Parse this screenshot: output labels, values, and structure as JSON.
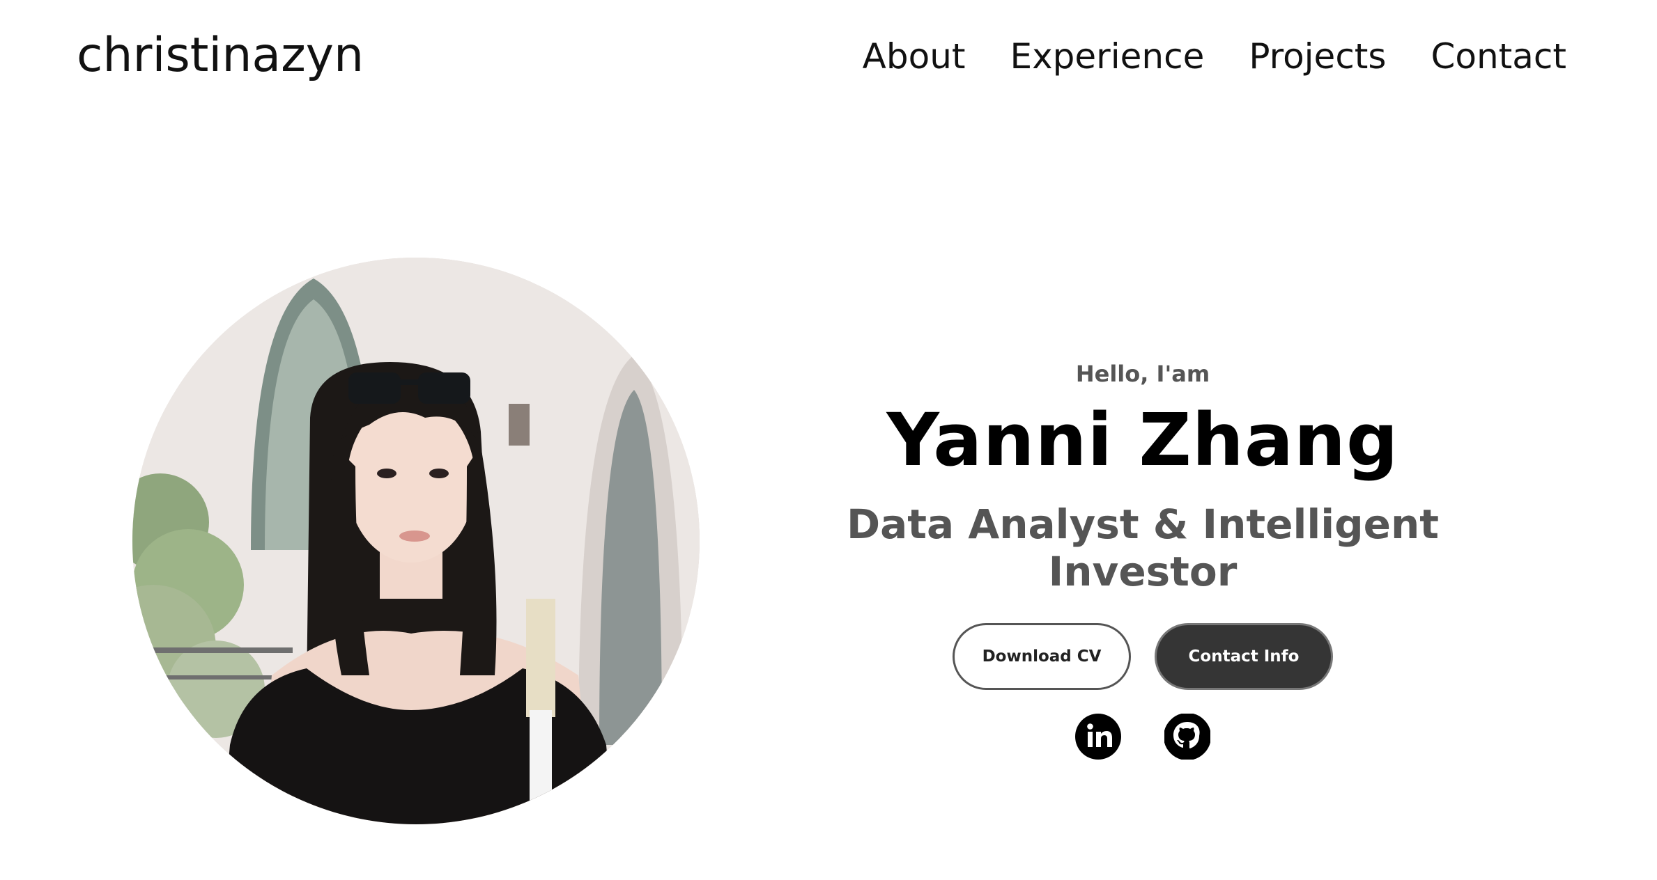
{
  "nav": {
    "logo": "christinazyn",
    "links": [
      "About",
      "Experience",
      "Projects",
      "Contact"
    ]
  },
  "hero": {
    "greeting": "Hello, I'am",
    "name": "Yanni Zhang",
    "title": "Data Analyst & Intelligent Investor",
    "buttons": {
      "download": "Download CV",
      "contact": "Contact Info"
    },
    "social": [
      {
        "icon": "linkedin-icon"
      },
      {
        "icon": "github-icon"
      }
    ]
  },
  "colors": {
    "text_dark": "#111111",
    "text_muted": "#555555",
    "button_dark": "#353535"
  }
}
